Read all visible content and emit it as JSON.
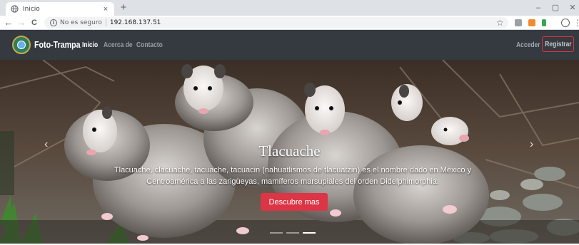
{
  "browser": {
    "tab_title": "Inicio",
    "tab_close": "×",
    "new_tab": "+",
    "window_controls": {
      "minimize": "–",
      "restore": "▢",
      "close": "✕"
    },
    "nav": {
      "back": "←",
      "forward": "→",
      "reload": "C"
    },
    "omnibox": {
      "info_icon": "ⓘ",
      "security_label": "No es seguro",
      "url": "192.168.137.51"
    },
    "bookmark_icon": "star-icon",
    "menu_icon": "⋮"
  },
  "site": {
    "brand": "Foto-Trampa",
    "nav_links": [
      "Inicio",
      "Acerca de",
      "Contacto"
    ],
    "acceder": "Acceder",
    "registrar": "Registrar",
    "colors": {
      "navbar": "#343a40",
      "accent": "#dc3545"
    }
  },
  "carousel": {
    "title": "Tlacuache",
    "description": "Tlacuache, clacuache, tacuache, tacuacin (nahuatlismos de tlacuatzin) es el nombre dado en México y Centroamérica a las zarigüeyas, mamíferos marsupiales del orden Didelphimorphia.",
    "button": "Descubre mas",
    "prev_icon": "‹",
    "next_icon": "›",
    "slides": 3,
    "active_slide": 3
  }
}
